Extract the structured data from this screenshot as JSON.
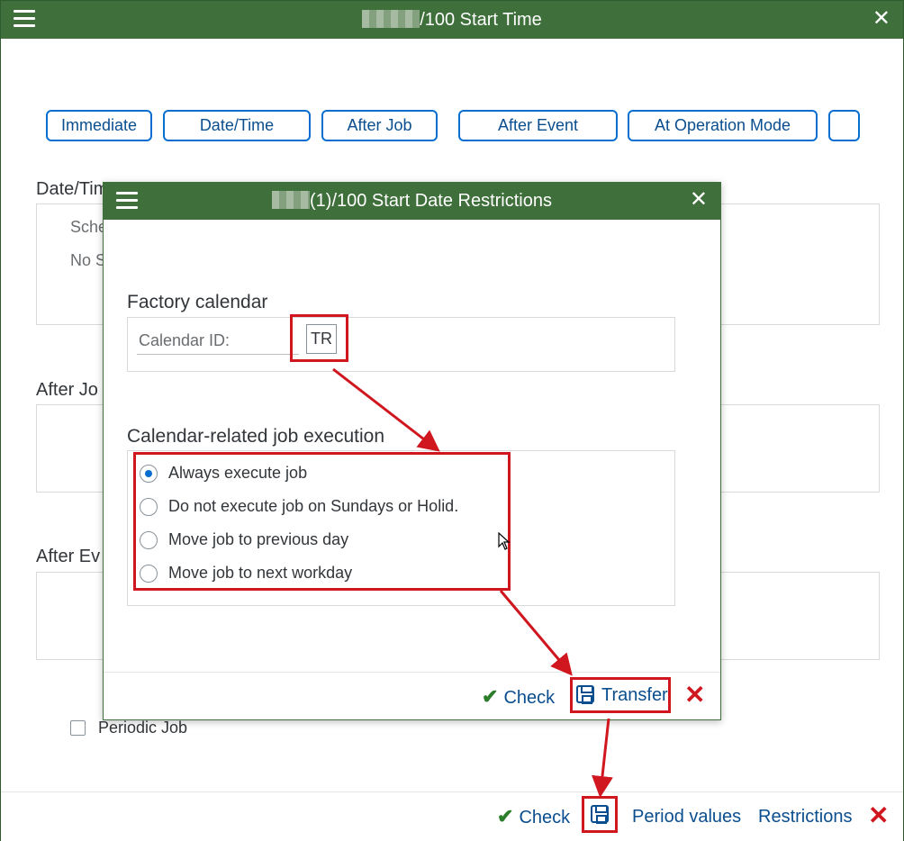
{
  "outer": {
    "title": "/100 Start Time",
    "start_buttons": [
      "Immediate",
      "Date/Time",
      "After Job",
      "After Event",
      "At Operation Mode"
    ],
    "section_datetime": "Date/Tim",
    "datetime_line1": "Sche",
    "datetime_line2": "No S",
    "section_afterjob": "After Jo",
    "section_afterevent": "After Ev",
    "periodic_job": "Periodic Job",
    "footer": {
      "check": "Check",
      "period_values": "Period values",
      "restrictions": "Restrictions"
    }
  },
  "dialog": {
    "title": "(1)/100 Start Date Restrictions",
    "factory_calendar_label": "Factory calendar",
    "calendar_id_label": "Calendar ID:",
    "calendar_id_value": "TR",
    "execution_label": "Calendar-related job execution",
    "options": [
      "Always execute job",
      "Do not execute job on Sundays or Holid.",
      "Move job to previous day",
      "Move job to next workday"
    ],
    "selected_option_index": 0,
    "footer": {
      "check": "Check",
      "transfer": "Transfer"
    }
  },
  "colors": {
    "titlebar": "#3f6f3a",
    "link": "#0a4e8f",
    "accent": "#0a6ed1",
    "annotation_red": "#d0161e",
    "check_green": "#2b7d2b"
  },
  "icons": [
    "menu-icon",
    "close-icon",
    "check-icon",
    "save-icon",
    "cancel-icon",
    "mouse-cursor-icon"
  ]
}
